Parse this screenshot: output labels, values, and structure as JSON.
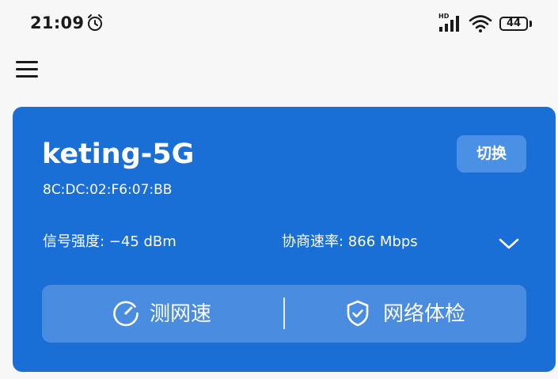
{
  "status_bar": {
    "time": "21:09",
    "battery": "44",
    "network_label": "HD",
    "icons": [
      "alarm-icon",
      "signal-icon",
      "wifi-icon",
      "battery-icon"
    ]
  },
  "header": {
    "menu_icon": "menu-icon"
  },
  "wifi": {
    "ssid": "keting-5G",
    "mac": "8C:DC:02:F6:07:BB",
    "switch_label": "切换",
    "signal_strength": "信号强度: −45 dBm",
    "link_rate": "协商速率: 866 Mbps",
    "expand_icon": "chevron-down-icon"
  },
  "actions": {
    "speed_test_label": "测网速",
    "speed_test_icon": "speedometer-icon",
    "network_check_label": "网络体检",
    "network_check_icon": "shield-check-icon"
  },
  "colors": {
    "card_background": "#1a6fd6",
    "button_background": "#4a8de0",
    "text_on_card": "#ffffff",
    "page_background": "#f7f7f8"
  }
}
